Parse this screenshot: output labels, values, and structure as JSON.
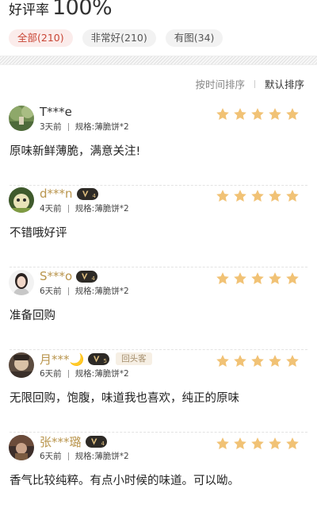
{
  "header": {
    "rating_label": "好评率",
    "rating_value": "100%"
  },
  "filters": [
    {
      "label": "全部(210)",
      "active": true
    },
    {
      "label": "非常好(210)",
      "active": false
    },
    {
      "label": "有图(34)",
      "active": false
    }
  ],
  "sort": {
    "options": [
      "按时间排序",
      "默认排序"
    ],
    "selected": 1
  },
  "colors": {
    "star": "#f1c275",
    "active_chip_text": "#c94636",
    "active_chip_bg": "#fbeceb",
    "vip_gold": "#b9954d"
  },
  "reviews": [
    {
      "user": "T***e",
      "vip": false,
      "vip_level": "",
      "returning": "",
      "time": "3天前",
      "spec": "规格:薄脆饼*2",
      "stars": 5,
      "text": "原味新鲜薄脆，满意关注!"
    },
    {
      "user": "d***n",
      "vip": true,
      "vip_level": "4",
      "returning": "",
      "time": "4天前",
      "spec": "规格:薄脆饼*2",
      "stars": 5,
      "text": "不错哦好评"
    },
    {
      "user": "S***o",
      "vip": true,
      "vip_level": "4",
      "returning": "",
      "time": "6天前",
      "spec": "规格:薄脆饼*2",
      "stars": 5,
      "text": "准备回购"
    },
    {
      "user": "月***🌙",
      "vip": true,
      "vip_level": "5",
      "returning": "回头客",
      "time": "6天前",
      "spec": "规格:薄脆饼*2",
      "stars": 5,
      "text": "无限回购，饱腹，味道我也喜欢，纯正的原味"
    },
    {
      "user": "张***璐",
      "vip": true,
      "vip_level": "4",
      "returning": "",
      "time": "6天前",
      "spec": "规格:薄脆饼*2",
      "stars": 5,
      "text": "香气比较纯粹。有点小时候的味道。可以呦。"
    }
  ]
}
